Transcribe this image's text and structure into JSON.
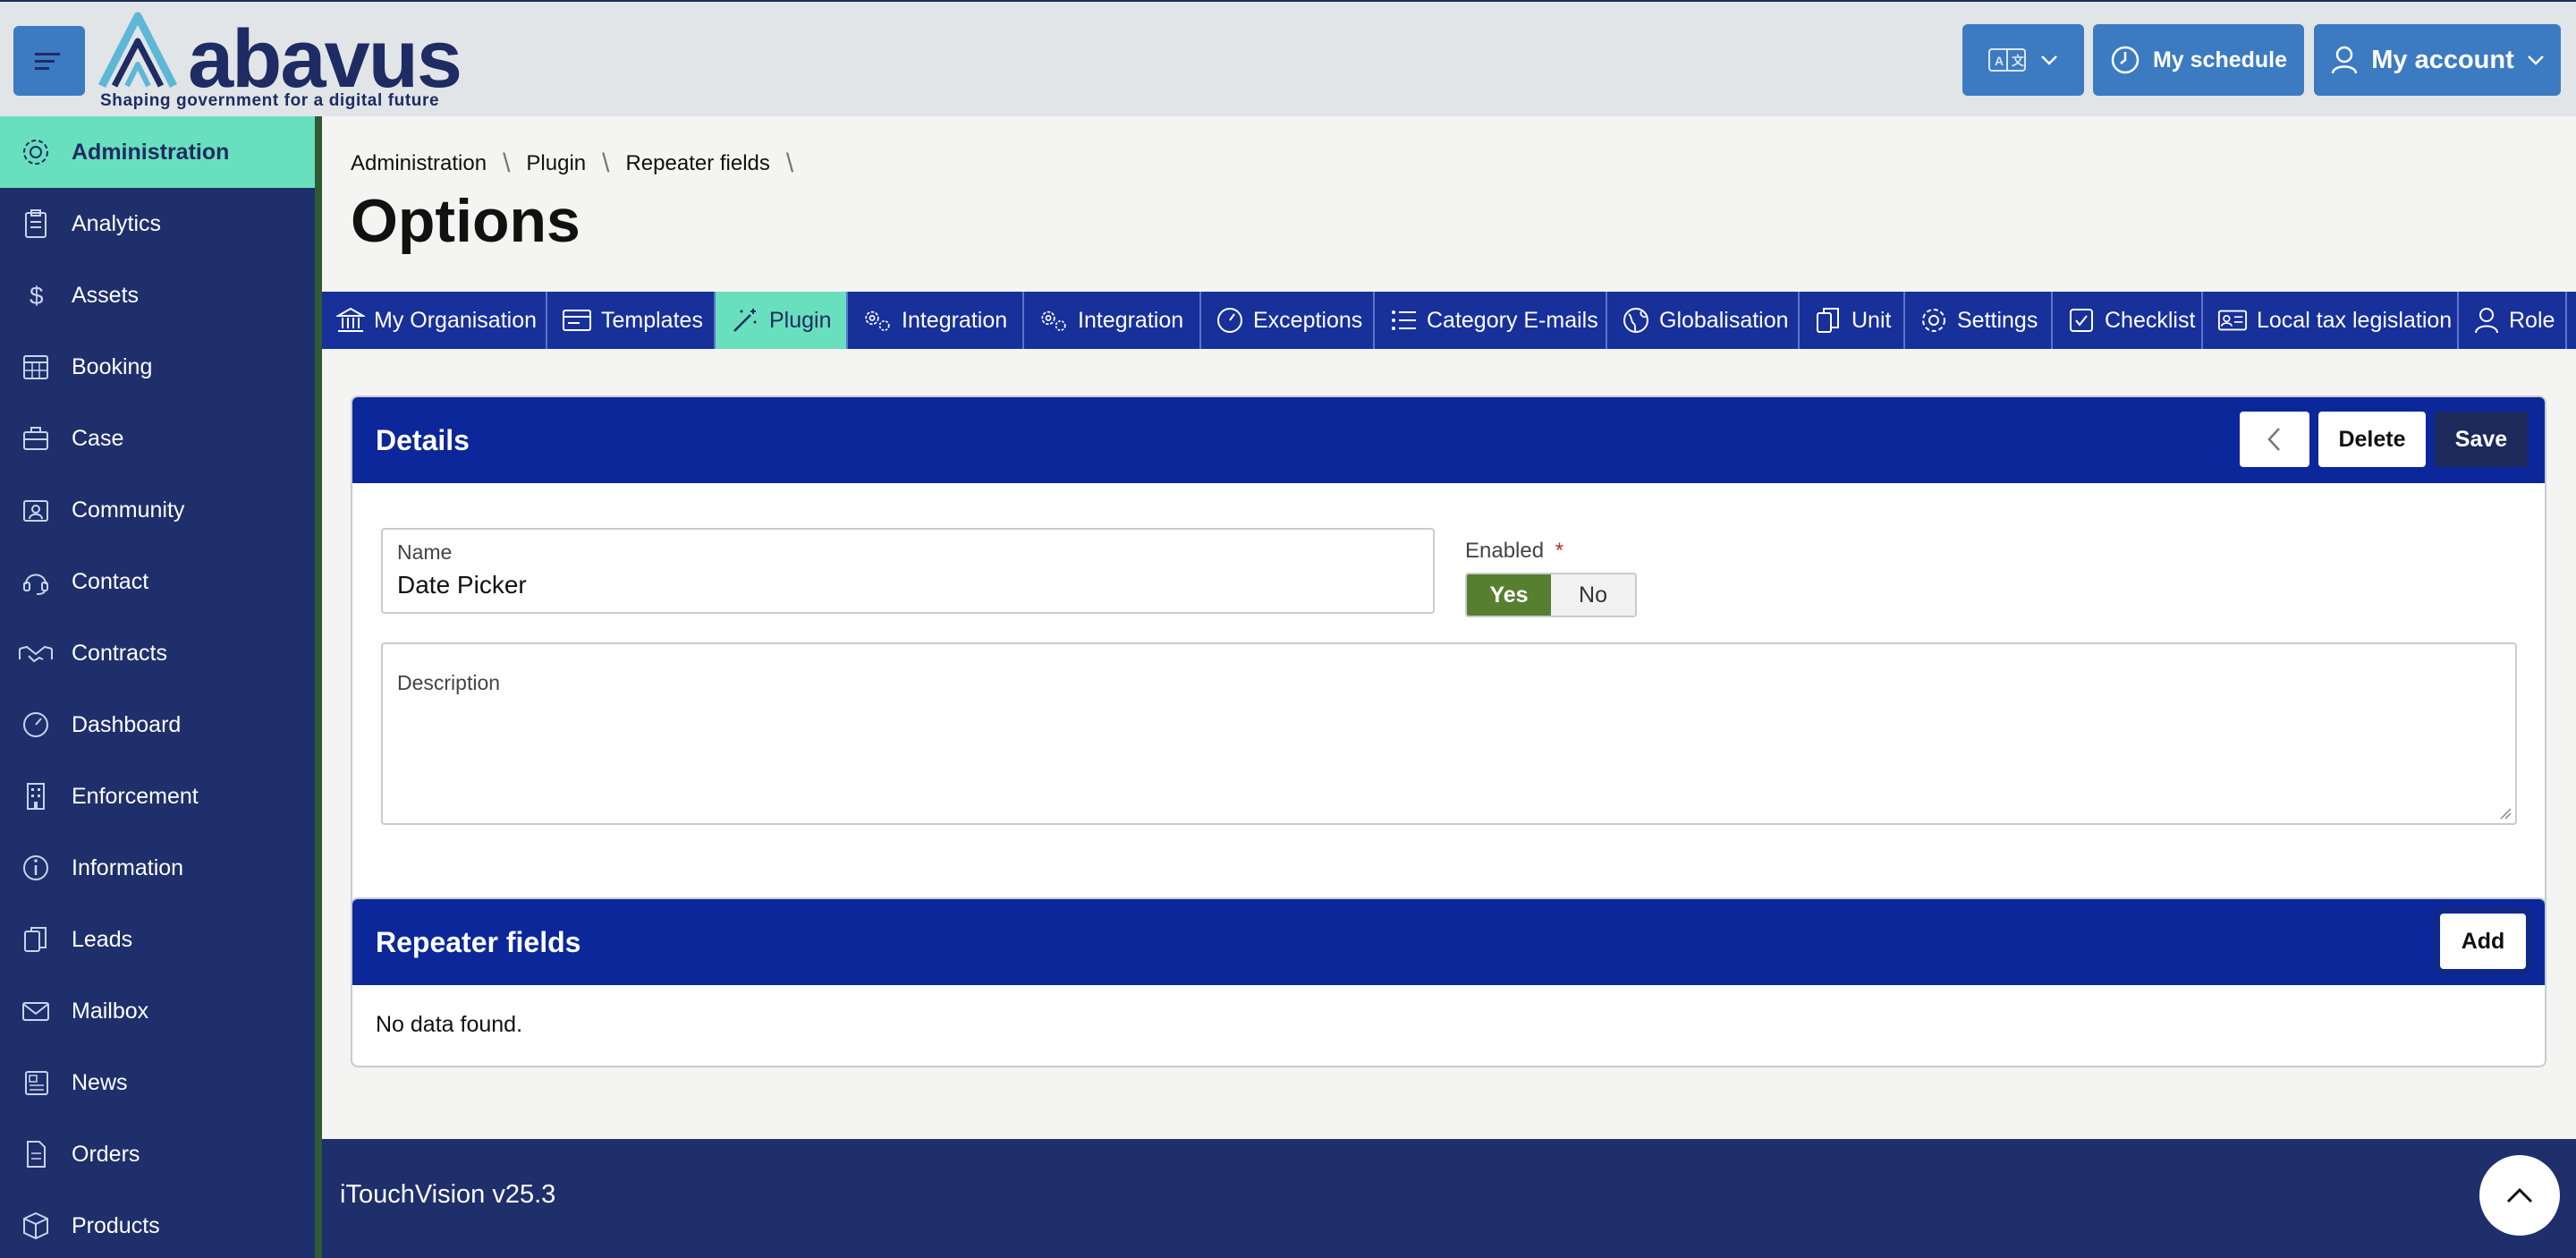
{
  "header": {
    "logo_text": "abavus",
    "logo_tagline": "Shaping government for a digital future",
    "schedule_label": "My schedule",
    "account_label": "My account",
    "icons": [
      "hamburger-icon",
      "translate-icon",
      "chevron-down-icon",
      "clock-icon",
      "user-icon"
    ]
  },
  "sidebar": {
    "items": [
      {
        "label": "Administration",
        "icon": "gear-icon",
        "active": true
      },
      {
        "label": "Analytics",
        "icon": "clipboard-icon"
      },
      {
        "label": "Assets",
        "icon": "dollar-icon"
      },
      {
        "label": "Booking",
        "icon": "calendar-icon"
      },
      {
        "label": "Case",
        "icon": "briefcase-icon"
      },
      {
        "label": "Community",
        "icon": "id-badge-icon"
      },
      {
        "label": "Contact",
        "icon": "headset-icon"
      },
      {
        "label": "Contracts",
        "icon": "handshake-icon"
      },
      {
        "label": "Dashboard",
        "icon": "speedometer-icon"
      },
      {
        "label": "Enforcement",
        "icon": "building-icon"
      },
      {
        "label": "Information",
        "icon": "info-icon"
      },
      {
        "label": "Leads",
        "icon": "documents-icon"
      },
      {
        "label": "Mailbox",
        "icon": "envelope-icon"
      },
      {
        "label": "News",
        "icon": "newspaper-icon"
      },
      {
        "label": "Orders",
        "icon": "file-icon"
      },
      {
        "label": "Products",
        "icon": "box-icon"
      }
    ]
  },
  "breadcrumb": [
    "Administration",
    "Plugin",
    "Repeater fields"
  ],
  "page_title": "Options",
  "tabs": [
    {
      "label": "My Organisation",
      "icon": "bank-icon"
    },
    {
      "label": "Templates",
      "icon": "template-icon"
    },
    {
      "label": "Plugin",
      "icon": "magic-wand-icon",
      "active": true
    },
    {
      "label": "Integration",
      "icon": "gears-icon"
    },
    {
      "label": "Integration",
      "icon": "gears-icon"
    },
    {
      "label": "Exceptions",
      "icon": "gauge-icon"
    },
    {
      "label": "Category E-mails",
      "icon": "list-icon"
    },
    {
      "label": "Globalisation",
      "icon": "globe-icon"
    },
    {
      "label": "Unit",
      "icon": "documents-icon"
    },
    {
      "label": "Settings",
      "icon": "gear-icon"
    },
    {
      "label": "Checklist",
      "icon": "checkbox-icon"
    },
    {
      "label": "Local tax legislation",
      "icon": "id-card-icon"
    },
    {
      "label": "Role",
      "icon": "user-icon"
    }
  ],
  "details": {
    "title": "Details",
    "delete_label": "Delete",
    "save_label": "Save",
    "name_label": "Name",
    "name_value": "Date Picker",
    "enabled_label": "Enabled",
    "required_mark": "*",
    "yes_label": "Yes",
    "no_label": "No",
    "enabled_value": "Yes",
    "description_label": "Description"
  },
  "repeater": {
    "title": "Repeater fields",
    "add_label": "Add",
    "empty_text": "No data found."
  },
  "footer": {
    "version_text": "iTouchVision v25.3"
  },
  "colors": {
    "primary_blue": "#0b2799",
    "sidebar_bg": "#1e2f6b",
    "accent_mint": "#69e0bd",
    "header_btn": "#3c7bc2",
    "toggle_on": "#577f30"
  }
}
